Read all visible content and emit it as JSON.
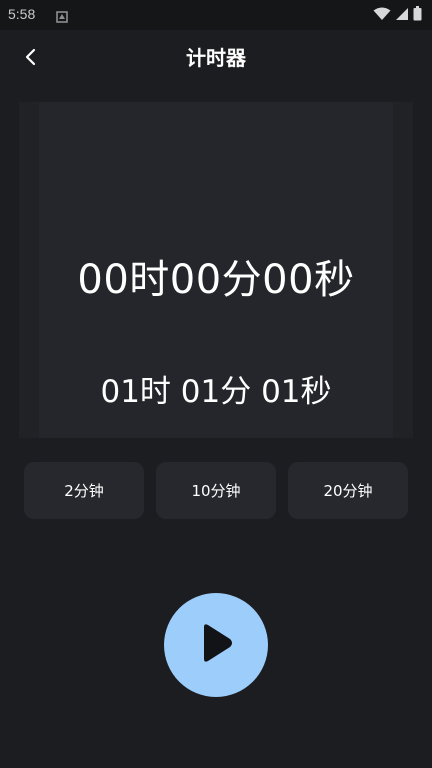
{
  "status_bar": {
    "time": "5:58",
    "icons": [
      "notification-icon",
      "wifi-icon",
      "signal-icon",
      "battery-icon"
    ]
  },
  "header": {
    "title": "计时器",
    "back_icon": "back-arrow-icon"
  },
  "timer": {
    "elapsed": "00时00分00秒",
    "target": "01时 01分 01秒"
  },
  "presets": [
    {
      "label": "2分钟"
    },
    {
      "label": "10分钟"
    },
    {
      "label": "20分钟"
    }
  ],
  "play_button": {
    "icon": "play-icon"
  },
  "colors": {
    "background": "#1c1d20",
    "panel": "#24262b",
    "preset_button": "#26282d",
    "accent": "#9dcdfb",
    "text": "#ffffff"
  }
}
